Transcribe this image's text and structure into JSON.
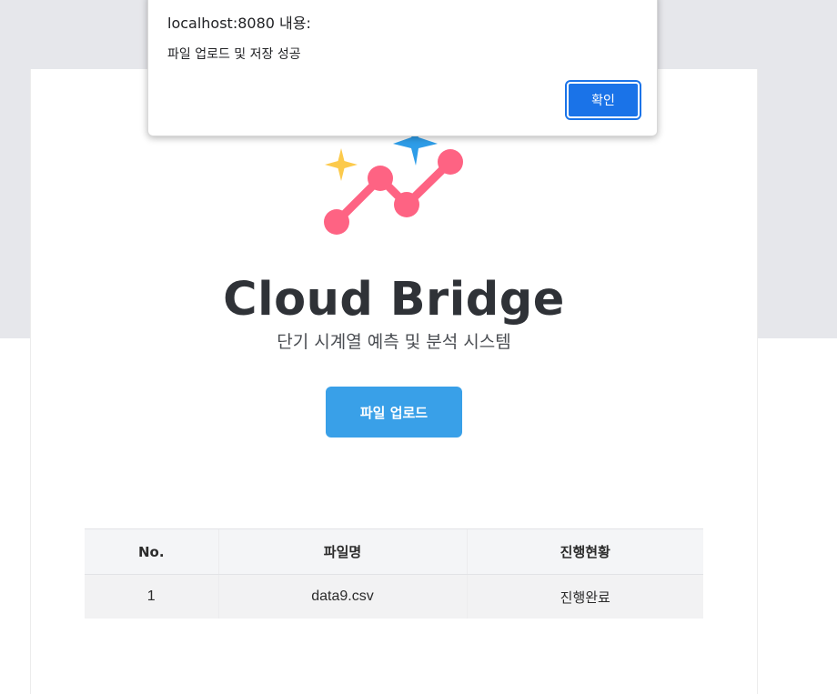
{
  "dialog": {
    "title": "localhost:8080 내용:",
    "message": "파일 업로드 및 저장 성공",
    "ok_label": "확인"
  },
  "logo": {
    "icon": "line-chart-sparkle-icon",
    "colors": {
      "line": "#fe6383",
      "sparkle_yellow": "#fcca4c",
      "sparkle_blue": "#2e9de8"
    }
  },
  "header": {
    "title": "Cloud Bridge",
    "subtitle": "단기 시계열 예측 및 분석 시스템"
  },
  "upload_button": {
    "label": "파일 업로드",
    "color": "#39a0e8"
  },
  "table": {
    "columns": [
      "No.",
      "파일명",
      "진행현황"
    ],
    "rows": [
      {
        "no": "1",
        "filename": "data9.csv",
        "status": "진행완료"
      }
    ]
  }
}
